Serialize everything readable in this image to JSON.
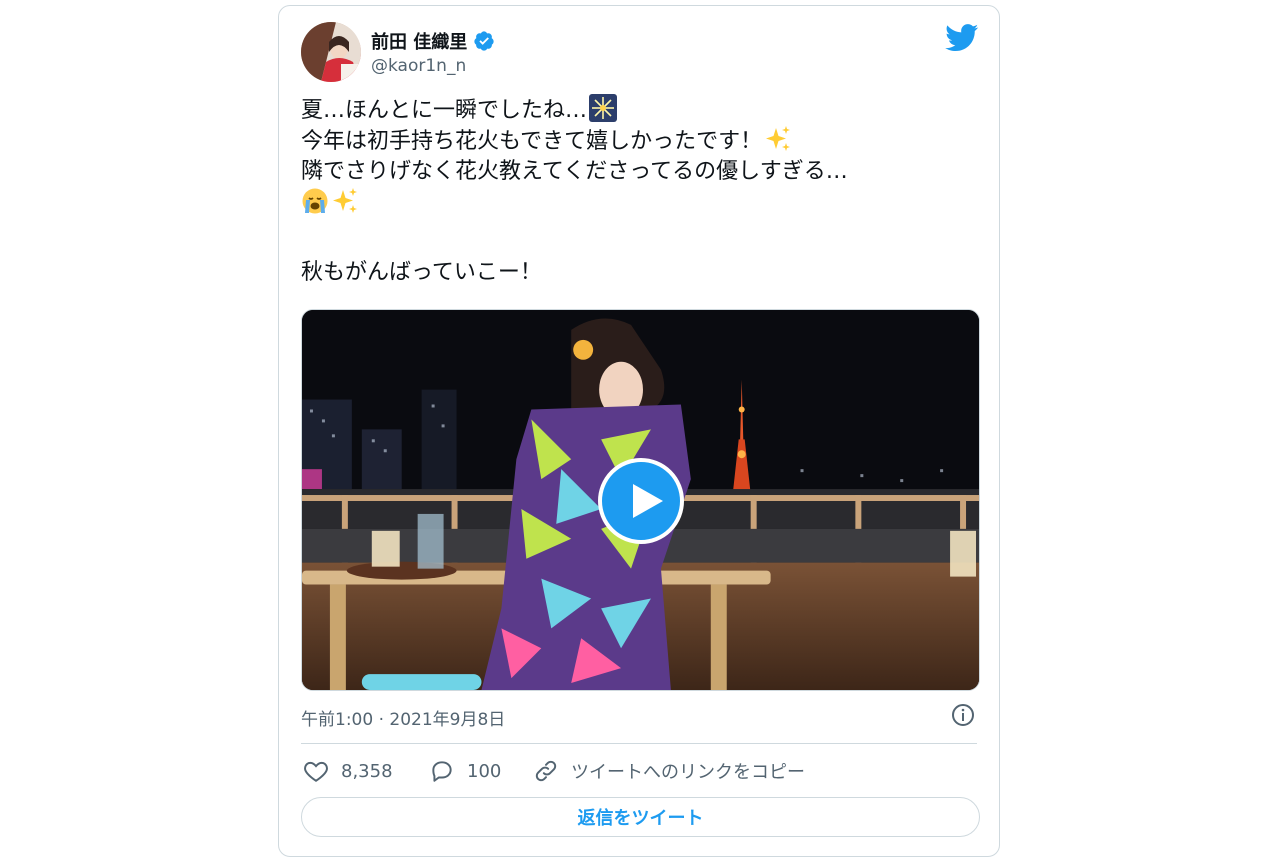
{
  "author": {
    "name": "前田 佳織里",
    "handle": "@kaor1n_n"
  },
  "tweet": {
    "lines": [
      "夏…ほんとに一瞬でしたね…",
      "今年は初手持ち花火もできて嬉しかったです！",
      "隣でさりげなく花火教えてくださってるの優しすぎる…",
      "",
      "",
      "秋もがんばっていこー！"
    ]
  },
  "emojis": [
    "fireworks-emoji",
    "sparkles-emoji",
    "crying-face-emoji",
    "sparkles-emoji"
  ],
  "media": {
    "type": "video",
    "play_icon": "play-icon"
  },
  "timestamp": "午前1:00 · 2021年9月8日",
  "actions": {
    "likes": "8,358",
    "replies": "100",
    "copy_link": "ツイートへのリンクをコピー"
  },
  "reply_button": "返信をツイート",
  "colors": {
    "accent": "#1d9bf0",
    "text": "#0f1419",
    "secondary": "#536471",
    "border": "#cfd9de"
  }
}
